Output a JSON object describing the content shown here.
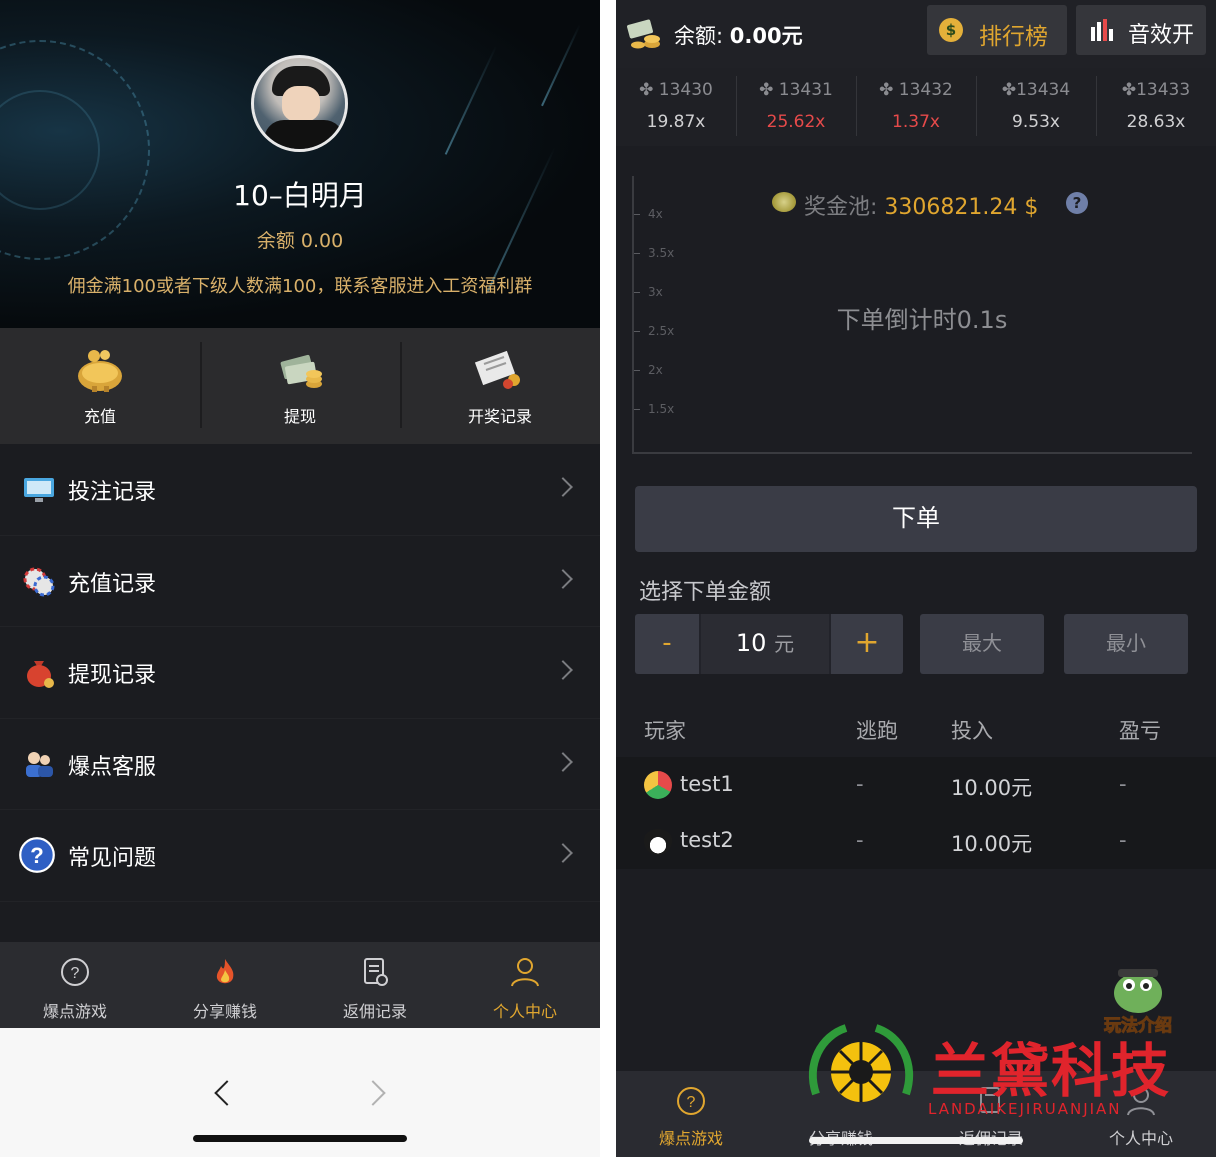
{
  "left": {
    "profile": {
      "username": "10–白明月",
      "balance": "余额 0.00",
      "notice": "佣金满100或者下级人数满100，联系客服进入工资福利群"
    },
    "quick_actions": [
      {
        "label": "充值",
        "icon": "piggy-bank-icon"
      },
      {
        "label": "提现",
        "icon": "money-stack-icon"
      },
      {
        "label": "开奖记录",
        "icon": "lottery-record-icon"
      }
    ],
    "menu": [
      {
        "label": "投注记录",
        "icon": "monitor-icon"
      },
      {
        "label": "充值记录",
        "icon": "chips-icon"
      },
      {
        "label": "提现记录",
        "icon": "money-bag-icon"
      },
      {
        "label": "爆点客服",
        "icon": "customer-service-icon"
      },
      {
        "label": "常见问题",
        "icon": "question-icon"
      }
    ],
    "tabbar": [
      {
        "label": "爆点游戏",
        "icon": "question-circle-icon",
        "active": false
      },
      {
        "label": "分享赚钱",
        "icon": "flame-icon",
        "active": false
      },
      {
        "label": "返佣记录",
        "icon": "document-icon",
        "active": false
      },
      {
        "label": "个人中心",
        "icon": "person-icon",
        "active": true
      }
    ]
  },
  "right": {
    "top_bar": {
      "balance_label": "余额:",
      "balance_value": "0.00元",
      "rank_label": "排行榜",
      "sound_label": "音效开"
    },
    "history": [
      {
        "id": "13430",
        "mult": "19.87x",
        "red": false
      },
      {
        "id": "13431",
        "mult": "25.62x",
        "red": true
      },
      {
        "id": "13432",
        "mult": "1.37x",
        "red": true
      },
      {
        "id": "13434",
        "mult": "9.53x",
        "red": false
      },
      {
        "id": "13433",
        "mult": "28.63x",
        "red": false
      }
    ],
    "chart": {
      "y_ticks": [
        "4x",
        "3.5x",
        "3x",
        "2.5x",
        "2x",
        "1.5x"
      ],
      "pool_label": "奖金池:",
      "pool_value": "3306821.24 $",
      "help": "?",
      "countdown": "下单倒计时0.1s"
    },
    "order_button": "下单",
    "amount": {
      "title": "选择下单金额",
      "minus": "-",
      "value": "10",
      "unit": "元",
      "plus": "+",
      "max": "最大",
      "min": "最小"
    },
    "table": {
      "headers": [
        "玩家",
        "逃跑",
        "投入",
        "盈亏"
      ],
      "rows": [
        {
          "player": "test1",
          "escape": "-",
          "bet": "10.00元",
          "profit": "-"
        },
        {
          "player": "test2",
          "escape": "-",
          "bet": "10.00元",
          "profit": "-"
        }
      ]
    },
    "mascot_text": "玩法介绍",
    "watermark": {
      "title": "兰黛科技",
      "subtitle": "LANDAIKEJIRUANJIAN"
    },
    "tabbar": [
      {
        "label": "爆点游戏",
        "active": true
      },
      {
        "label": "分享赚钱",
        "active": false
      },
      {
        "label": "返佣记录",
        "active": false
      },
      {
        "label": "个人中心",
        "active": false
      }
    ]
  },
  "colors": {
    "accent": "#e0a62f",
    "loss": "#e64a4a",
    "background": "#1c1d22"
  }
}
